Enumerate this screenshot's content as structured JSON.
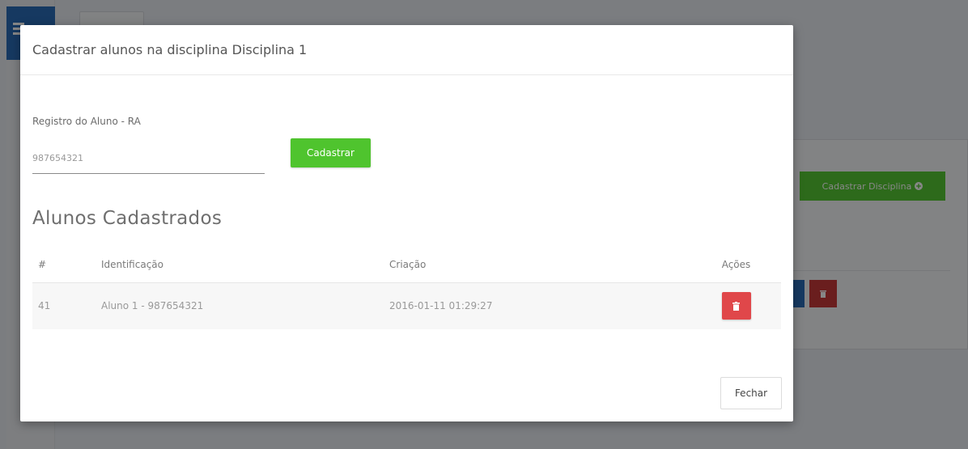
{
  "modal": {
    "title": "Cadastrar alunos na disciplina Disciplina 1",
    "form": {
      "label": "Registro do Aluno - RA",
      "input_value": "987654321",
      "submit_label": "Cadastrar"
    },
    "section_title": "Alunos Cadastrados",
    "table": {
      "headers": [
        "#",
        "Identificação",
        "Criação",
        "Ações"
      ],
      "rows": [
        {
          "id": "41",
          "identificacao": "Aluno 1 - 987654321",
          "criacao": "2016-01-11 01:29:27"
        }
      ]
    },
    "close_label": "Fechar"
  },
  "background": {
    "add_button_label": "Cadastrar Disciplina"
  },
  "colors": {
    "success": "#4fc42e",
    "danger": "#e0474a",
    "primary": "#2a6cb8"
  },
  "icons": {
    "delete": "trash-icon",
    "add": "plus-circle-icon",
    "menu": "hamburger-icon"
  }
}
